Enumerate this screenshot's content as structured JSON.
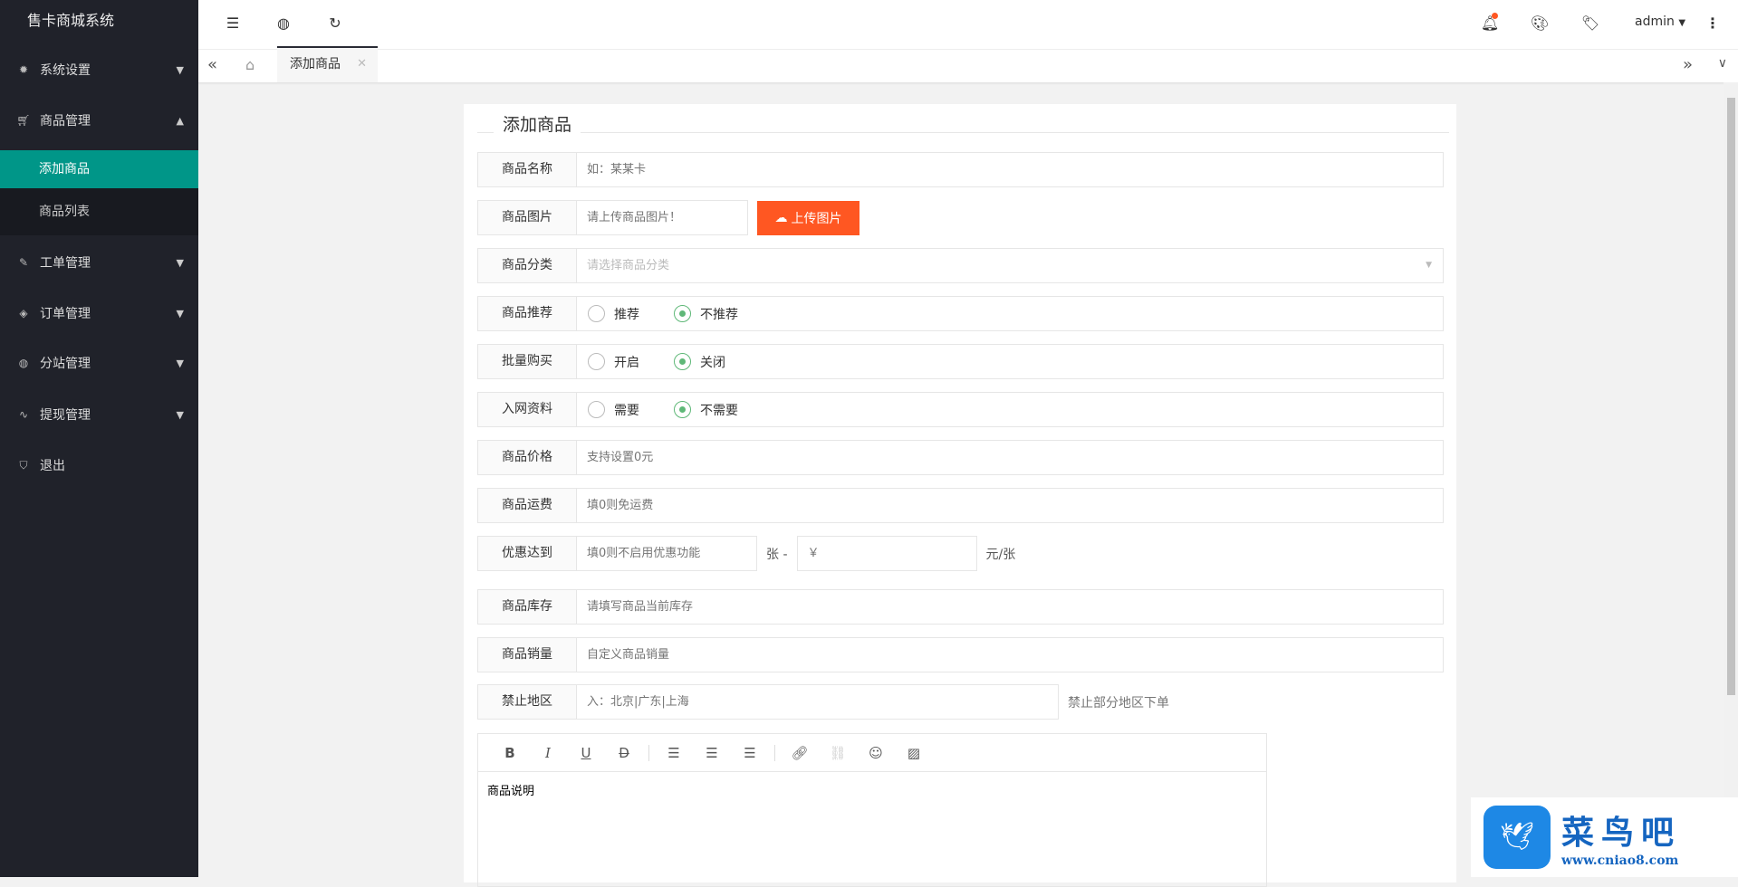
{
  "app": {
    "title": "售卡商城系统"
  },
  "sidebar": {
    "items": [
      {
        "label": "系统设置",
        "icon": "gear-icon"
      },
      {
        "label": "商品管理",
        "icon": "cart-icon",
        "sub": [
          {
            "label": "添加商品"
          },
          {
            "label": "商品列表"
          }
        ]
      },
      {
        "label": "工单管理",
        "icon": "edit-icon"
      },
      {
        "label": "订单管理",
        "icon": "layers-icon"
      },
      {
        "label": "分站管理",
        "icon": "globe-icon"
      },
      {
        "label": "提现管理",
        "icon": "pulse-icon"
      },
      {
        "label": "退出",
        "icon": "shield-icon"
      }
    ]
  },
  "header": {
    "user": "admin"
  },
  "tabs": [
    {
      "label": "添加商品"
    }
  ],
  "form": {
    "title": "添加商品",
    "name": {
      "label": "商品名称",
      "placeholder": "如：某某卡"
    },
    "image": {
      "label": "商品图片",
      "placeholder": "请上传商品图片！",
      "button": "上传图片"
    },
    "category": {
      "label": "商品分类",
      "placeholder": "请选择商品分类"
    },
    "recommend": {
      "label": "商品推荐",
      "options": [
        "推荐",
        "不推荐"
      ],
      "selected": "不推荐"
    },
    "bulk": {
      "label": "批量购买",
      "options": [
        "开启",
        "关闭"
      ],
      "selected": "关闭"
    },
    "netinfo": {
      "label": "入网资料",
      "options": [
        "需要",
        "不需要"
      ],
      "selected": "不需要"
    },
    "price": {
      "label": "商品价格",
      "placeholder": "支持设置0元"
    },
    "shipping": {
      "label": "商品运费",
      "placeholder": "填0则免运费"
    },
    "discount": {
      "label": "优惠达到",
      "placeholder": "填0则不启用优惠功能",
      "sep": "张 -",
      "price_placeholder": "￥",
      "unit": "元/张"
    },
    "stock": {
      "label": "商品库存",
      "placeholder": "请填写商品当前库存"
    },
    "sales": {
      "label": "商品销量",
      "placeholder": "自定义商品销量"
    },
    "region": {
      "label": "禁止地区",
      "placeholder": "入：北京|广东|上海",
      "hint": "禁止部分地区下单"
    },
    "editor": {
      "content": "商品说明"
    }
  },
  "watermark": {
    "name": "菜鸟吧",
    "url": "www.cniao8.com"
  }
}
